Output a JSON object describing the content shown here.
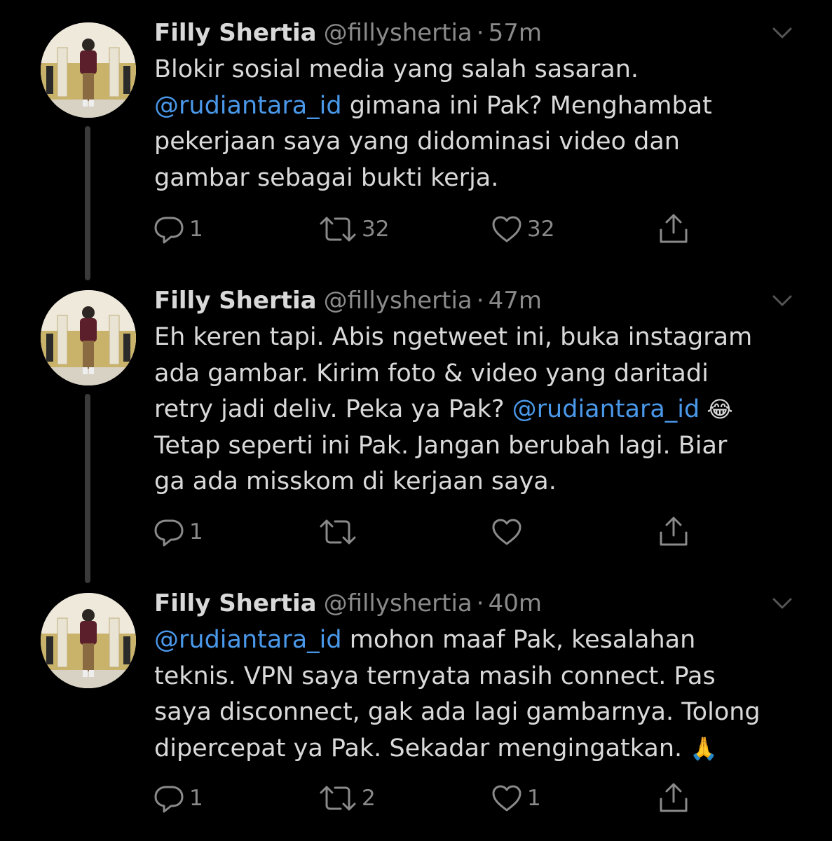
{
  "tweets": [
    {
      "name": "Filly Shertia",
      "handle": "@fillyshertia",
      "sep": "·",
      "time": "57m",
      "lines": [
        [
          {
            "t": "Blokir sosial media yang salah sasaran."
          }
        ],
        [
          {
            "t": "@rudiantara_id",
            "m": true
          },
          {
            "t": " gimana ini Pak? Menghambat"
          }
        ],
        [
          {
            "t": "pekerjaan saya yang didominasi video dan"
          }
        ],
        [
          {
            "t": "gambar sebagai bukti kerja."
          }
        ]
      ],
      "replies": "1",
      "retweets": "32",
      "likes": "32"
    },
    {
      "name": "Filly Shertia",
      "handle": "@fillyshertia",
      "sep": "·",
      "time": "47m",
      "lines": [
        [
          {
            "t": "Eh keren tapi. Abis ngetweet ini, buka instagram"
          }
        ],
        [
          {
            "t": "ada gambar. Kirim foto & video yang daritadi"
          }
        ],
        [
          {
            "t": "retry jadi deliv. Peka ya Pak? "
          },
          {
            "t": "@rudiantara_id",
            "m": true
          },
          {
            "t": " 😂",
            "e": true
          }
        ],
        [
          {
            "t": "Tetap seperti ini Pak. Jangan berubah lagi. Biar"
          }
        ],
        [
          {
            "t": "ga ada misskom di kerjaan saya."
          }
        ]
      ],
      "replies": "1",
      "retweets": "",
      "likes": ""
    },
    {
      "name": "Filly Shertia",
      "handle": "@fillyshertia",
      "sep": "·",
      "time": "40m",
      "lines": [
        [
          {
            "t": "@rudiantara_id",
            "m": true
          },
          {
            "t": " mohon maaf Pak, kesalahan"
          }
        ],
        [
          {
            "t": "teknis. VPN saya ternyata masih connect. Pas"
          }
        ],
        [
          {
            "t": "saya disconnect, gak ada lagi gambarnya. Tolong"
          }
        ],
        [
          {
            "t": "dipercepat ya Pak. Sekadar mengingatkan. "
          },
          {
            "t": "🙏",
            "e": true
          }
        ]
      ],
      "replies": "1",
      "retweets": "2",
      "likes": "1"
    }
  ],
  "icons": {
    "reply": "reply-icon",
    "retweet": "retweet-icon",
    "like": "heart-icon",
    "share": "share-icon",
    "caret": "chevron-down-icon"
  },
  "colors": {
    "background": "#000000",
    "text": "#d9d9d9",
    "muted": "#8a8a8a",
    "mention": "#4a98e9",
    "thread_line": "#3a3a3a"
  }
}
